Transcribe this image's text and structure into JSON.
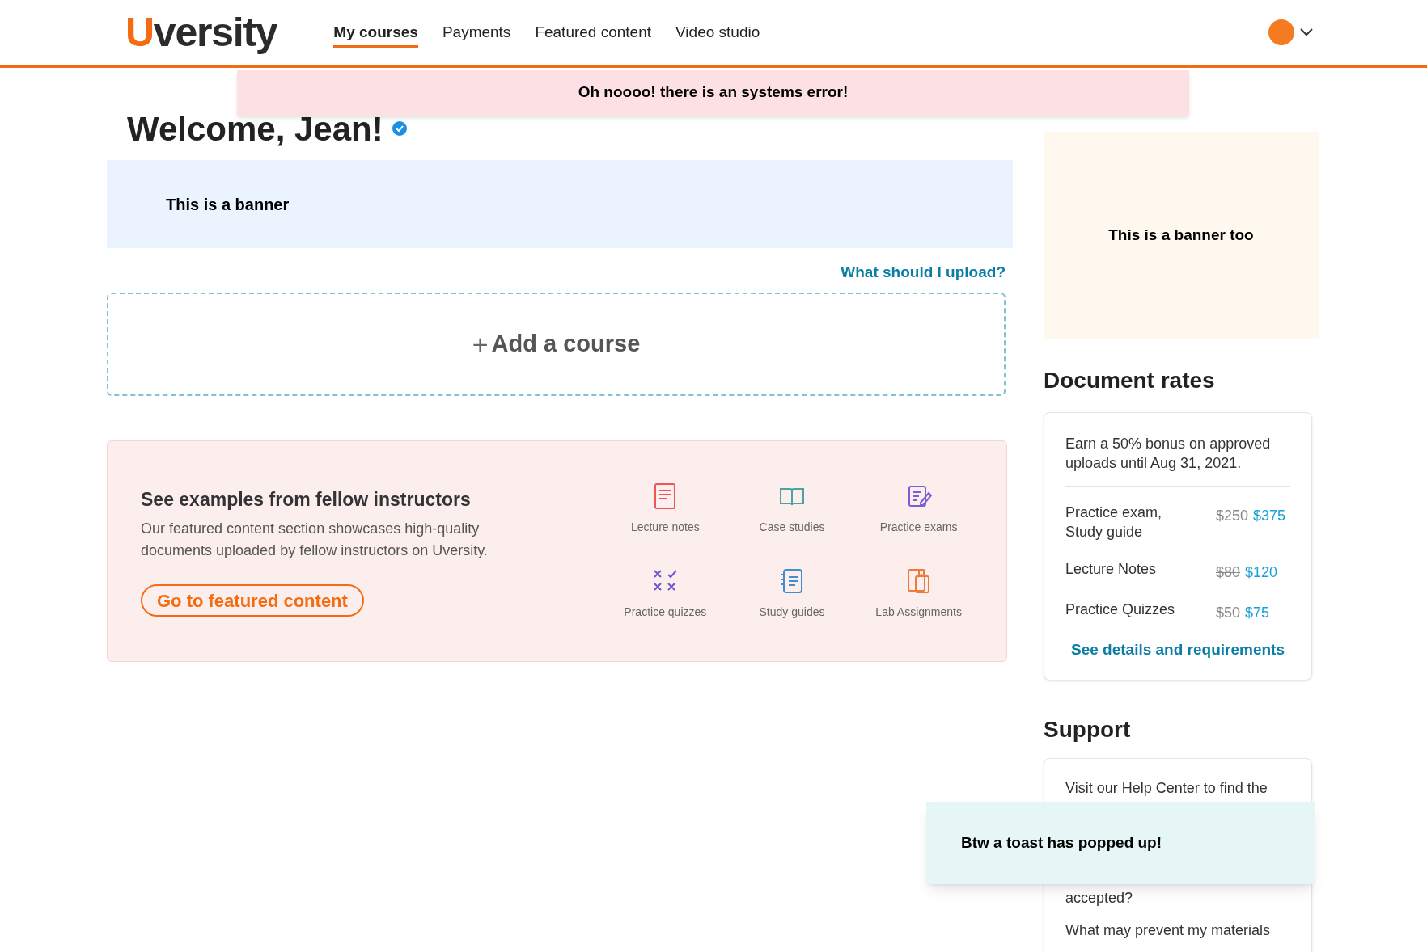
{
  "header": {
    "logo": "Uversity",
    "nav": [
      {
        "label": "My courses",
        "selected": true
      },
      {
        "label": "Payments",
        "selected": false
      },
      {
        "label": "Featured content",
        "selected": false
      },
      {
        "label": "Video studio",
        "selected": false
      }
    ]
  },
  "error_alert": "Oh noooo! there is an systems error!",
  "welcome": {
    "title": "Welcome, Jean!",
    "verified": true
  },
  "banner": "This is a banner",
  "upload_link": "What should I upload?",
  "add_course": {
    "icon": "+",
    "label": "Add a course"
  },
  "featured": {
    "title": "See examples from fellow instructors",
    "text": "Our featured content section showcases high-quality documents uploaded by fellow instructors on Uversity.",
    "button": "Go to featured content",
    "types": [
      {
        "kind": "notes",
        "label": "Lecture notes",
        "color": "#f05454"
      },
      {
        "kind": "book",
        "label": "Case studies",
        "color": "#4aa3a0"
      },
      {
        "kind": "exam",
        "label": "Practice exams",
        "color": "#7b5fd6"
      },
      {
        "kind": "quiz",
        "label": "Practice quizzes",
        "color": "#6e55d0"
      },
      {
        "kind": "guide",
        "label": "Study guides",
        "color": "#3d8fd1"
      },
      {
        "kind": "lab",
        "label": "Lab Assignments",
        "color": "#f07a3a"
      }
    ]
  },
  "side_banner": "This is a banner too",
  "document_rates": {
    "title": "Document rates",
    "intro": "Earn a 50% bonus on approved uploads until Aug 31, 2021.",
    "rows": [
      {
        "label": "Practice exam, Study guide",
        "old": "$250",
        "new": "$375"
      },
      {
        "label": "Lecture Notes",
        "old": "$80",
        "new": "$120"
      },
      {
        "label": "Practice Quizzes",
        "old": "$50",
        "new": "$75"
      }
    ],
    "link": "See details and requirements"
  },
  "support": {
    "title": "Support",
    "lines": [
      "Visit our Help Center to find the",
      "accepted?",
      "What may prevent my materials"
    ]
  },
  "toast": "Btw a toast has popped up!"
}
